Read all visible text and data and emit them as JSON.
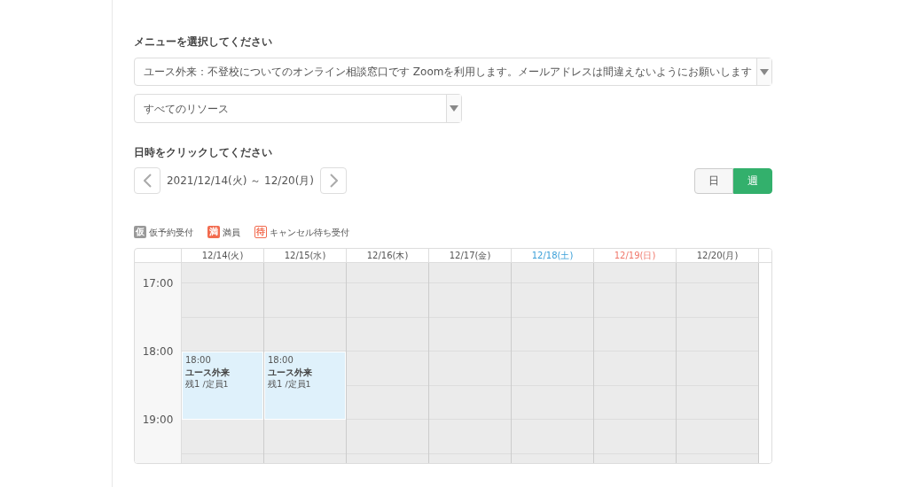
{
  "menu_label": "メニューを選択してください",
  "menu_select": {
    "value": "ユース外来：不登校についてのオンライン相談窓口です Zoomを利用します。メールアドレスは間違えないようにお願いします"
  },
  "resource_select": {
    "value": "すべてのリソース"
  },
  "date_label": "日時をクリックしてください",
  "date_range": "2021/12/14(火) ～ 12/20(月)",
  "view_toggle": [
    {
      "label": "日",
      "selected": false
    },
    {
      "label": "週",
      "selected": true
    }
  ],
  "legend": [
    {
      "kind": "filled",
      "mark": "仮",
      "label": "仮予約受付",
      "color": "#999999"
    },
    {
      "kind": "filled",
      "mark": "満",
      "label": "満員",
      "color": "#f26b4f"
    },
    {
      "kind": "outline",
      "mark": "待",
      "label": "キャンセル待ち受付",
      "color": "#f26b4f"
    }
  ],
  "times": [
    "17:00",
    "18:00",
    "19:00"
  ],
  "days": [
    {
      "label": "12/14(火)",
      "color": "#555555",
      "events": [
        {
          "time": "18:00",
          "title": "ユース外来",
          "remaining": "残1",
          "capacity": "/定員1"
        }
      ]
    },
    {
      "label": "12/15(水)",
      "color": "#555555",
      "events": [
        {
          "time": "18:00",
          "title": "ユース外来",
          "remaining": "残1",
          "capacity": "/定員1"
        }
      ]
    },
    {
      "label": "12/16(木)",
      "color": "#555555"
    },
    {
      "label": "12/17(金)",
      "color": "#555555"
    },
    {
      "label": "12/18(土)",
      "color": "#3a9fd8"
    },
    {
      "label": "12/19(日)",
      "color": "#f0776a"
    },
    {
      "label": "12/20(月)",
      "color": "#555555"
    }
  ]
}
